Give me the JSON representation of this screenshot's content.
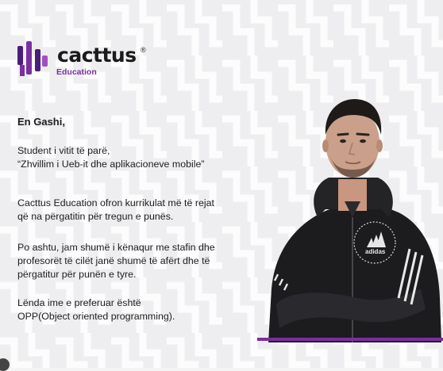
{
  "brand": {
    "name": "cacttus",
    "registered": "®",
    "sub": "Education",
    "accent_color": "#7b2fa0",
    "mark_color": "#4a1d7a"
  },
  "testimonial": {
    "greeting": "En Gashi,",
    "p1": [
      "Student i vitit të parë,",
      "“Zhvillim i Ueb-it dhe aplikacioneve mobile”"
    ],
    "p2": [
      "Cacttus Education ofron kurrikulat më të rejat",
      "që na përgatitin për tregun e punës."
    ],
    "p3": [
      "Po ashtu, jam shumë i kënaqur me stafin dhe",
      "profesorët të cilët janë shumë të afërt dhe të",
      "përgatitur për punën e tyre."
    ],
    "p4": [
      "Lënda ime e preferuar është",
      "OPP(Object oriented programming)."
    ]
  },
  "hoodie_print": "adidas"
}
